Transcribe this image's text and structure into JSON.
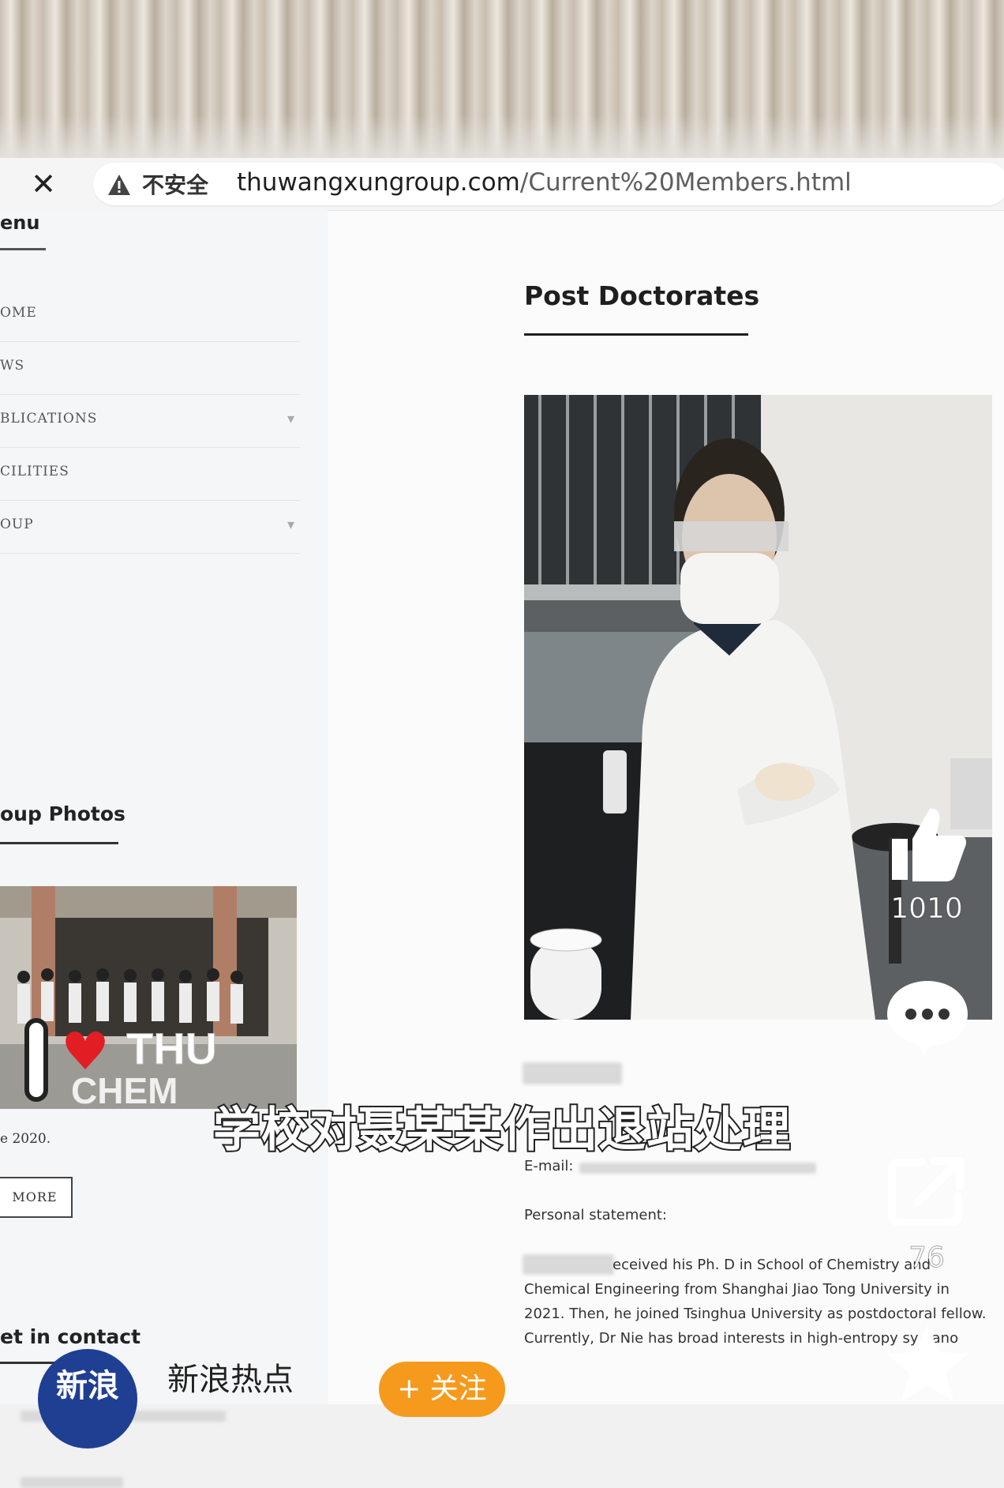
{
  "browser": {
    "close_glyph": "✕",
    "security_label": "不安全",
    "url_domain": "thuwangxungroup.com",
    "url_path": "/Current%20Members.html"
  },
  "sidebar": {
    "menu_heading": "enu",
    "items": [
      {
        "label": "OME",
        "has_chevron": false
      },
      {
        "label": "WS",
        "has_chevron": false
      },
      {
        "label": "BLICATIONS",
        "has_chevron": true
      },
      {
        "label": "CILITIES",
        "has_chevron": false
      },
      {
        "label": "OUP",
        "has_chevron": true
      }
    ],
    "chevron_glyph": "▾",
    "group_photos_heading": "oup Photos",
    "photo_caption": "e 2020.",
    "more_button": "MORE",
    "contact_heading": "et in contact"
  },
  "main": {
    "heading": "Post Doctorates",
    "email_label": "E-mail:",
    "statement_label": "Personal statement:",
    "statement_lines": [
      "eceived his Ph. D in School of Chemistry and",
      "Chemical Engineering from Shanghai Jiao Tong University in",
      "2021. Then, he joined Tsinghua University as postdoctoral fellow.",
      "Currently, Dr Nie has broad interests in high-entropy sy   nano"
    ]
  },
  "overlay": {
    "subtitle": "学校对聂某某作出退站处理",
    "like_count": "1010",
    "share_count": "76",
    "account_avatar_text": "新浪",
    "account_name": "新浪热点",
    "follow_button": "+ 关注"
  },
  "colors": {
    "follow": "#f59a1d",
    "avatar": "#1f3f93"
  },
  "icons": [
    "warning-icon",
    "close-icon",
    "like-icon",
    "comment-icon",
    "share-icon",
    "star-icon"
  ]
}
